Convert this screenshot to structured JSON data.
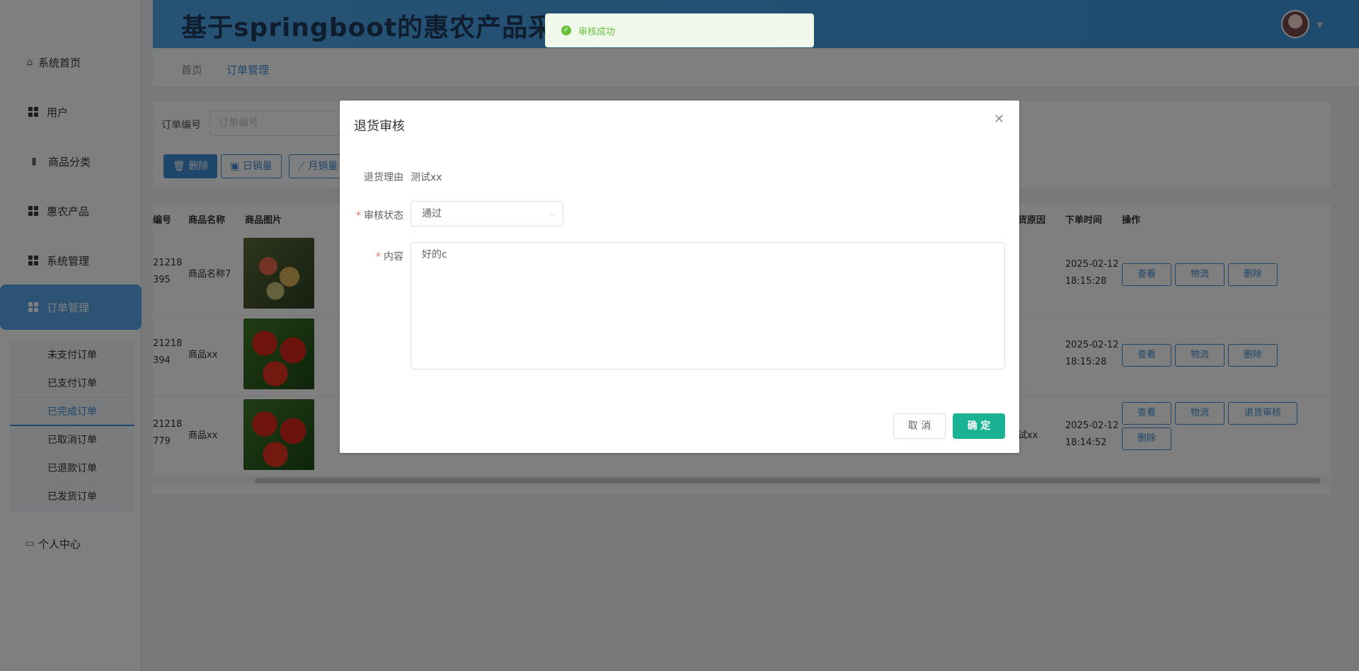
{
  "header": {
    "title": "基于springboot的惠农产品采购"
  },
  "breadcrumb": {
    "home": "首页",
    "current": "订单管理"
  },
  "sidebar": {
    "home": "系统首页",
    "items": [
      {
        "label": "用户"
      },
      {
        "label": "商品分类"
      },
      {
        "label": "惠农产品"
      },
      {
        "label": "系统管理"
      },
      {
        "label": "订单管理"
      }
    ],
    "sub_items": [
      {
        "label": "未支付订单"
      },
      {
        "label": "已支付订单"
      },
      {
        "label": "已完成订单"
      },
      {
        "label": "已取消订单"
      },
      {
        "label": "已退款订单"
      },
      {
        "label": "已发货订单"
      }
    ],
    "profile": "个人中心"
  },
  "search": {
    "label": "订单编号",
    "placeholder": "订单编号",
    "delete_btn": "删除",
    "daily_btn": "日销量",
    "monthly_btn": "月销量"
  },
  "table": {
    "columns": {
      "id": "编号",
      "name": "商品名称",
      "image": "商品图片",
      "reason": "货原因",
      "time": "下单时间",
      "ops": "操作"
    },
    "rows": [
      {
        "id1": "21218",
        "id2": "395",
        "name": "商品名称7",
        "reason": "",
        "date": "2025-02-12",
        "time": "18:15:28"
      },
      {
        "id1": "21218",
        "id2": "394",
        "name": "商品xx",
        "reason": "",
        "date": "2025-02-12",
        "time": "18:15:28"
      },
      {
        "id1": "21218",
        "id2": "779",
        "name": "商品xx",
        "reason": "试xx",
        "date": "2025-02-12",
        "time": "18:14:52"
      }
    ],
    "actions": {
      "view": "查看",
      "logistics": "物流",
      "delete": "删除",
      "return_review": "退货审核"
    }
  },
  "toast": {
    "message": "审核成功"
  },
  "dialog": {
    "title": "退货审核",
    "reason_label": "退货理由",
    "reason_value": "测试xx",
    "status_label": "审核状态",
    "status_value": "通过",
    "content_label": "内容",
    "content_value": "好的c",
    "cancel": "取 消",
    "confirm": "确 定"
  },
  "colors": {
    "primary": "#3c8dd6",
    "confirm": "#19b394",
    "success": "#67c23a"
  }
}
